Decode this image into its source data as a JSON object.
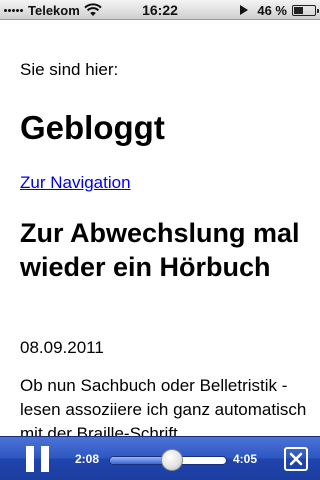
{
  "statusbar": {
    "carrier": "Telekom",
    "time": "16:22",
    "battery_percent": "46 %",
    "battery_level": 0.46
  },
  "page": {
    "breadcrumb_label": "Sie sind hier:",
    "site_title": "Gebloggt",
    "nav_link": "Zur Navigation",
    "post_title": "Zur Abwechslung mal wieder ein Hörbuch",
    "post_date": "08.09.2011",
    "post_text": "Ob nun Sachbuch oder Belletristik - lesen assoziiere ich ganz automatisch mit der Braille-Schrift."
  },
  "player": {
    "elapsed": "2:08",
    "remaining": "4:05",
    "progress": 0.53
  },
  "icons": {
    "signal": "signal-bars-icon",
    "wifi": "wifi-icon",
    "play": "play-indicator-icon",
    "battery": "battery-icon",
    "pause": "pause-icon",
    "close": "close-icon"
  }
}
